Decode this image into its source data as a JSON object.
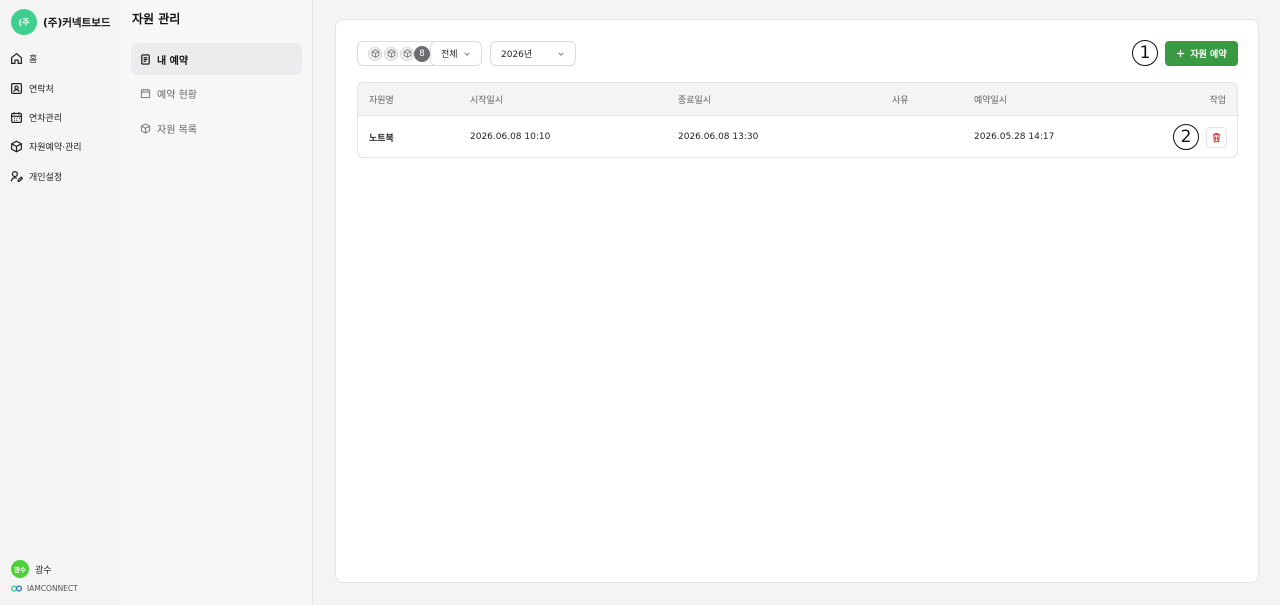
{
  "brand": {
    "logo_text": "(주",
    "name": "(주)커넥트보드"
  },
  "nav": {
    "items": [
      {
        "label": "홈",
        "icon": "home-icon"
      },
      {
        "label": "연락처",
        "icon": "contact-icon"
      },
      {
        "label": "연차관리",
        "icon": "calendar-icon"
      },
      {
        "label": "자원예약·관리",
        "icon": "cube-icon"
      },
      {
        "label": "개인설정",
        "icon": "user-settings-icon"
      }
    ]
  },
  "user": {
    "avatar_text": "광수",
    "name": "광수"
  },
  "company": {
    "name": "IAMCONNECT"
  },
  "subsidebar": {
    "title": "자원 관리",
    "items": [
      {
        "label": "내 예약",
        "icon": "document-icon",
        "active": true
      },
      {
        "label": "예약 현황",
        "icon": "calendar-icon",
        "active": false
      },
      {
        "label": "자원 목록",
        "icon": "cube-icon",
        "active": false
      }
    ]
  },
  "filters": {
    "resource_count": "8",
    "resource_select": "전체",
    "year_select": "2026년"
  },
  "markers": {
    "m1": "1",
    "m2": "2"
  },
  "toolbar": {
    "add_label": "자원 예약",
    "add_icon": "plus-icon"
  },
  "table": {
    "columns": [
      "자원명",
      "시작일시",
      "종료일시",
      "사유",
      "예약일시",
      "작업"
    ],
    "rows": [
      {
        "resource": "노트북",
        "start": "2026.06.08 10:10",
        "end": "2026.06.08 13:30",
        "reason": "",
        "reserved_at": "2026.05.28 14:17",
        "action_icon": "trash-icon"
      }
    ]
  },
  "colors": {
    "accent_green": "#3a9a44",
    "brand_green": "#3fcf8e",
    "danger_red": "#d33"
  }
}
